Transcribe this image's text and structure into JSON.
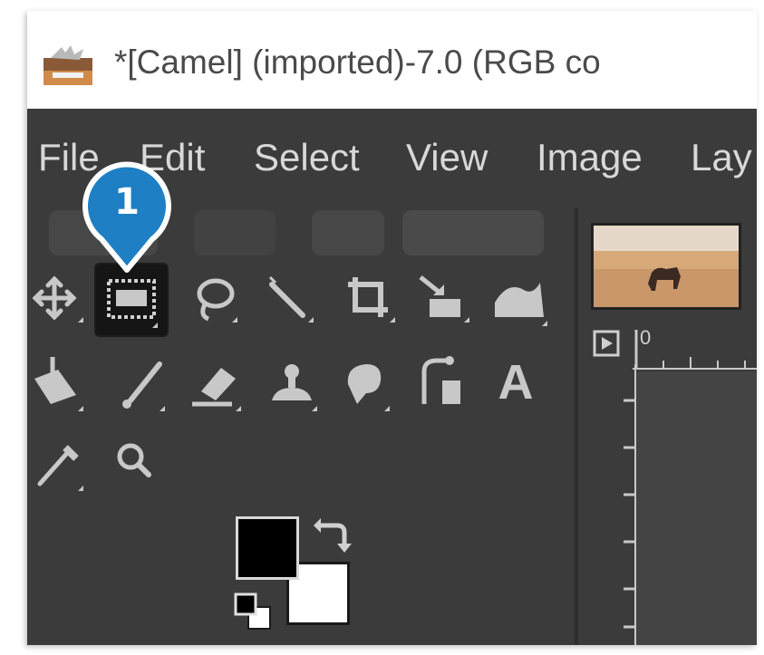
{
  "window": {
    "title": "*[Camel] (imported)-7.0 (RGB co"
  },
  "menu": {
    "items": [
      "File",
      "Edit",
      "Select",
      "View",
      "Image",
      "Lay"
    ]
  },
  "toolbox": {
    "active_tool": "rectangle-select",
    "tools_row1": [
      "move-tool-icon",
      "rectangle-select-icon",
      "free-select-icon",
      "fuzzy-select-icon",
      "crop-icon",
      "transform-icon",
      "warp-icon"
    ],
    "tools_row2": [
      "bucket-fill-icon",
      "paintbrush-icon",
      "eraser-icon",
      "clone-icon",
      "smudge-icon",
      "paths-icon",
      "text-icon"
    ],
    "tools_row3": [
      "color-picker-icon",
      "zoom-icon"
    ],
    "text_tool_label": "A"
  },
  "colors": {
    "foreground": "#000000",
    "background": "#ffffff",
    "accent": "#1e7fc4"
  },
  "ruler": {
    "origin_label": "0"
  },
  "callout": {
    "number": "1"
  }
}
